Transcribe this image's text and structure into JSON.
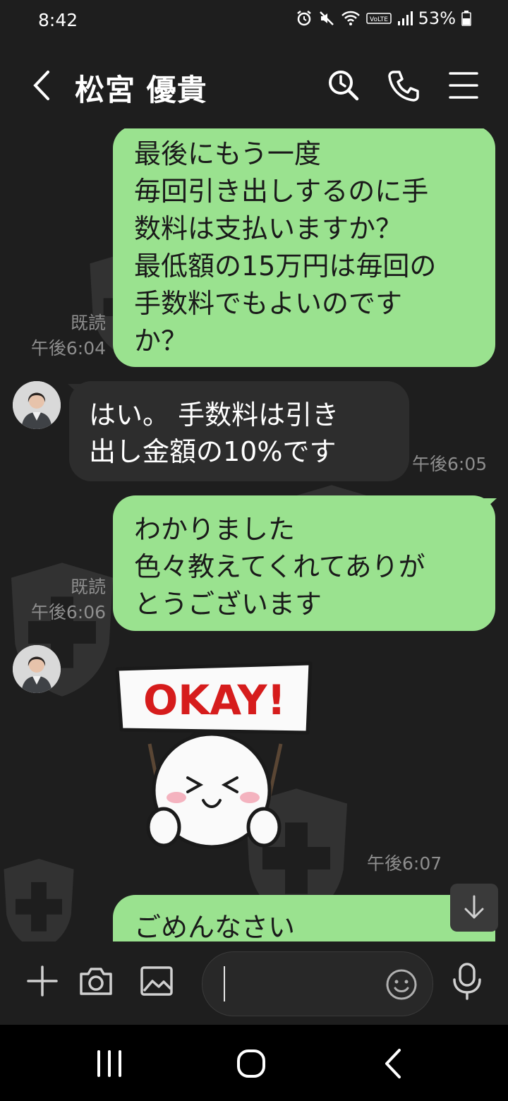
{
  "status_bar": {
    "time": "8:42",
    "battery": "53%"
  },
  "header": {
    "title": "松宮 優貴"
  },
  "messages": [
    {
      "type": "outgoing",
      "text": "最後にもう一度\n毎回引き出しするのに手\n数料は支払いますか？\n最低額の15万円は毎回の\n手数料でもよいのです\nか？",
      "read": "既読",
      "time": "午後6:04"
    },
    {
      "type": "incoming",
      "text": "はい。 手数料は引き\n出し金額の10%です",
      "time": "午後6:05"
    },
    {
      "type": "outgoing",
      "text": "わかりました\n色々教えてくれてありが\nとうございます",
      "read": "既読",
      "time": "午後6:06"
    },
    {
      "type": "sticker",
      "sign_text": "OKAY!",
      "time": "午後6:07"
    },
    {
      "type": "outgoing",
      "text": "ごめんなさい"
    }
  ],
  "input": {
    "placeholder": ""
  },
  "colors": {
    "outgoing_bubble": "#9ae28f",
    "incoming_bubble": "#2d2d2d",
    "background": "#1e1e1e",
    "sticker_text": "#d61c1c"
  }
}
